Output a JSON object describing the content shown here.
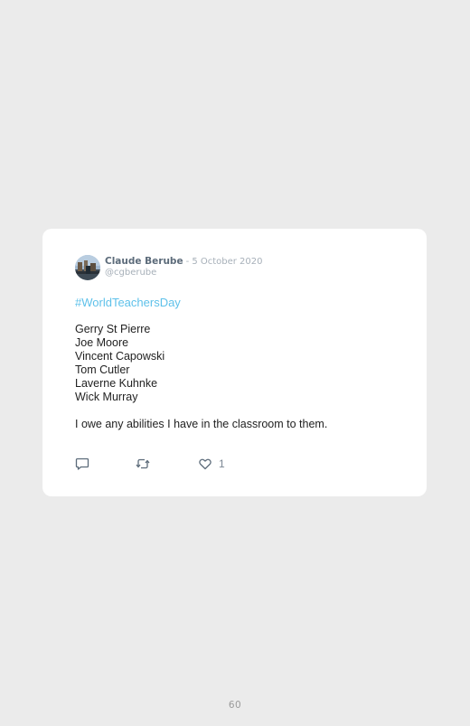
{
  "tweet": {
    "author_name": "Claude Berube",
    "separator": "-",
    "date": "5 October 2020",
    "handle": "@cgberube",
    "hashtag": "#WorldTeachersDay",
    "names": [
      "Gerry St Pierre",
      "Joe Moore",
      "Vincent Capowski",
      "Tom Cutler",
      "Laverne Kuhnke",
      "Wick Murray"
    ],
    "closing_text": "I owe any abilities I have in the classroom to them.",
    "like_count": "1",
    "icons": {
      "reply": "reply-icon",
      "retweet": "retweet-icon",
      "like": "heart-icon",
      "avatar": "avatar"
    },
    "colors": {
      "hashtag": "#5ec1ea",
      "author": "#5c6b7a",
      "muted": "#a7b0b9",
      "background": "#ebebeb",
      "card": "#ffffff"
    }
  },
  "page": {
    "number": "60"
  }
}
